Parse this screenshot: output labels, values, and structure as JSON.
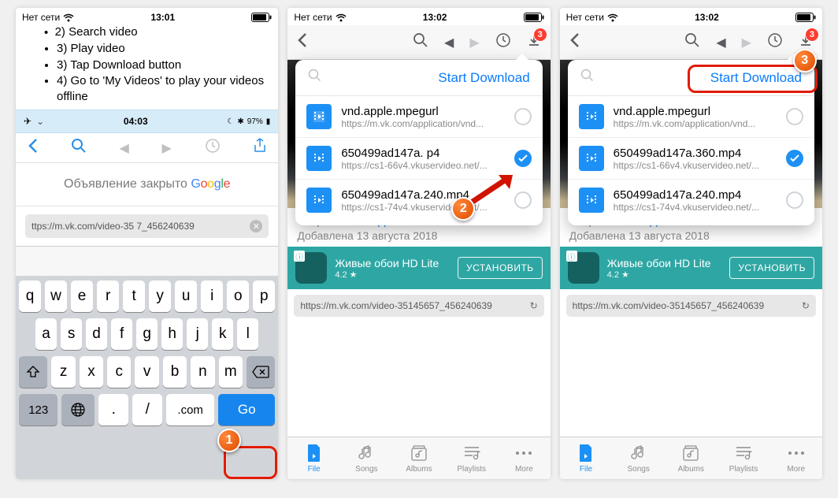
{
  "status": {
    "carrier": "Нет сети"
  },
  "phone1": {
    "time": "13:01",
    "instructions": [
      "2) Search video",
      "3) Play video",
      "3) Tap Download button",
      "4) Go to 'My Videos' to play your videos offline"
    ],
    "mediabar_time": "04:03",
    "ad_text": "Объявление закрыто",
    "ad_google": "Google",
    "url": "ttps://m.vk.com/video-35             7_456240639",
    "keyboard": {
      "row1": [
        "q",
        "w",
        "e",
        "r",
        "t",
        "y",
        "u",
        "i",
        "o",
        "p"
      ],
      "row2": [
        "a",
        "s",
        "d",
        "f",
        "g",
        "h",
        "j",
        "k",
        "l"
      ],
      "row3": [
        "z",
        "x",
        "c",
        "v",
        "b",
        "n",
        "m"
      ],
      "bottom": {
        "num": "123",
        "dot": ".",
        "slash": "/",
        "com": ".com",
        "go": "Go"
      }
    }
  },
  "phone23": {
    "time": "13:02",
    "badge": "3",
    "start_download": "Start Download",
    "files": [
      {
        "title": "vnd.apple.mpegurl",
        "sub": "https://m.vk.com/application/vnd...",
        "checked": false
      },
      {
        "title": "650499ad147a.360.mp4",
        "sub": "https://cs1-66v4.vkuservideo.net/...",
        "checked": true
      },
      {
        "title": "650499ad147a.240.mp4",
        "sub": "https://cs1-74v4.vkuservideo.net/...",
        "checked": false
      }
    ],
    "files_p2_middle_title": "650499ad147a.         p4",
    "sender_label": "Отправитель:",
    "sender_name": "Apple",
    "date": "Добавлена 13 августа 2018",
    "ad_title": "Живые обои HD Lite",
    "ad_rating": "4.2 ★",
    "ad_btn": "УСТАНОВИТЬ",
    "url": "https://m.vk.com/video-35145657_456240639",
    "tabs": [
      "File",
      "Songs",
      "Albums",
      "Playlists",
      "More"
    ]
  }
}
